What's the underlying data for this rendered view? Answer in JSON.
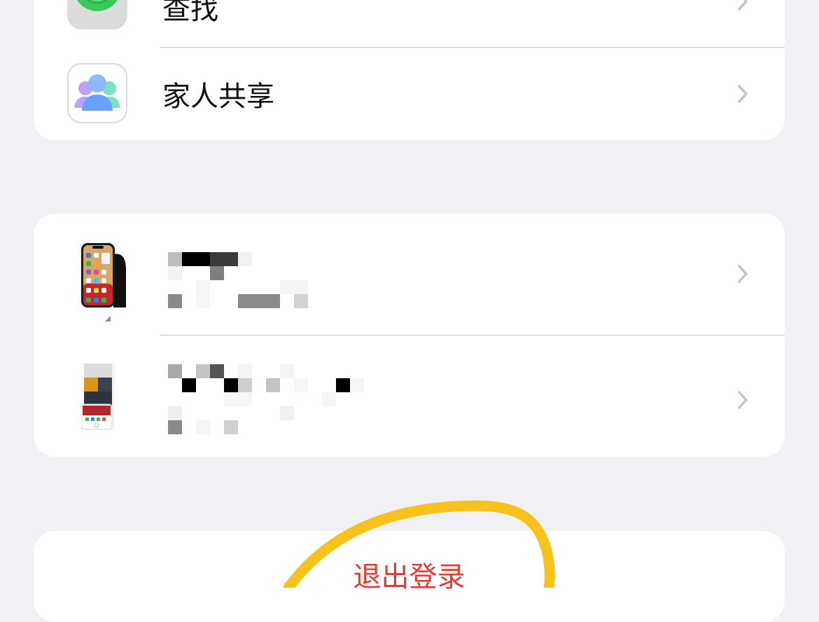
{
  "apple_id_menu": {
    "find_my": {
      "label": "查找",
      "icon": "find-my-icon"
    },
    "family_sharing": {
      "label": "家人共享",
      "icon": "family-sharing-icon"
    }
  },
  "devices": [
    {
      "icon": "iphone-icon"
    },
    {
      "icon": "iphone-home-button-icon"
    }
  ],
  "sign_out": {
    "label": "退出登录",
    "color": "#e23d34"
  },
  "colors": {
    "background": "#f0f0f5",
    "card": "#ffffff",
    "chevron": "#c4c4c7",
    "annotation": "#f7c21b"
  }
}
